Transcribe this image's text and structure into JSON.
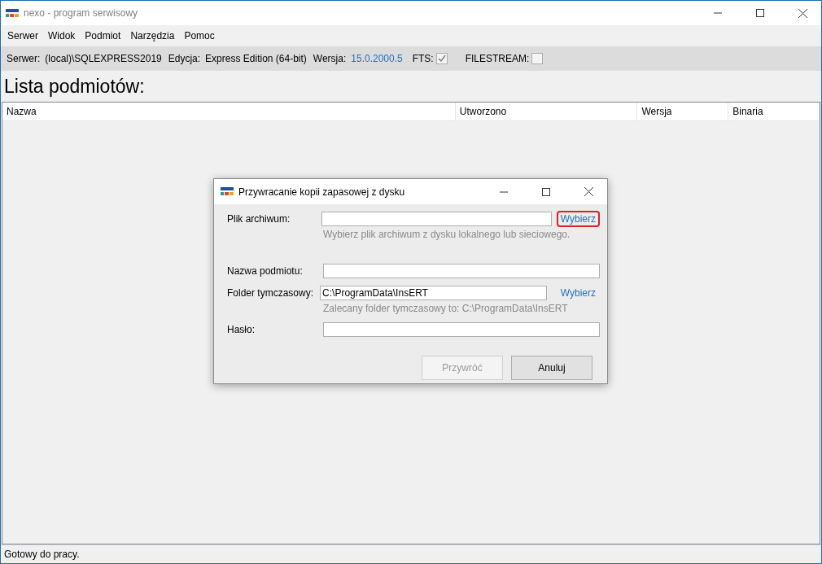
{
  "window": {
    "title": "nexo - program serwisowy"
  },
  "menu": [
    "Serwer",
    "Widok",
    "Podmiot",
    "Narzędzia",
    "Pomoc"
  ],
  "info_bar": {
    "server_label": "Serwer:",
    "server": "(local)\\SQLEXPRESS2019",
    "edition_label": "Edycja:",
    "edition": "Express Edition (64-bit)",
    "version_label": "Wersja:",
    "version": "15.0.2000.5",
    "fts_label": "FTS:",
    "fts_checked": true,
    "filestream_label": "FILESTREAM:",
    "filestream_checked": false
  },
  "heading": "Lista podmiotów:",
  "table": {
    "columns": [
      "Nazwa",
      "Utworzono",
      "Wersja",
      "Binaria"
    ]
  },
  "dialog": {
    "title": "Przywracanie kopii zapasowej z dysku",
    "fields": [
      {
        "label": "Plik archiwum:",
        "link": "Wybierz",
        "link_highlighted": true,
        "hint": "Wybierz plik archiwum z dysku lokalnego lub sieciowego."
      },
      {
        "label": "Nazwa podmiotu:"
      },
      {
        "label": "Folder tymczasowy:",
        "value": "C:\\ProgramData\\InsERT",
        "link": "Wybierz",
        "link_highlighted": false,
        "hint": "Zalecany folder tymczasowy to: C:\\ProgramData\\InsERT"
      },
      {
        "label": "Hasło:"
      }
    ],
    "buttons": [
      {
        "label": "Przywróć",
        "disabled": true
      },
      {
        "label": "Anuluj",
        "disabled": false
      }
    ]
  },
  "status_bar": "Gotowy do pracy."
}
